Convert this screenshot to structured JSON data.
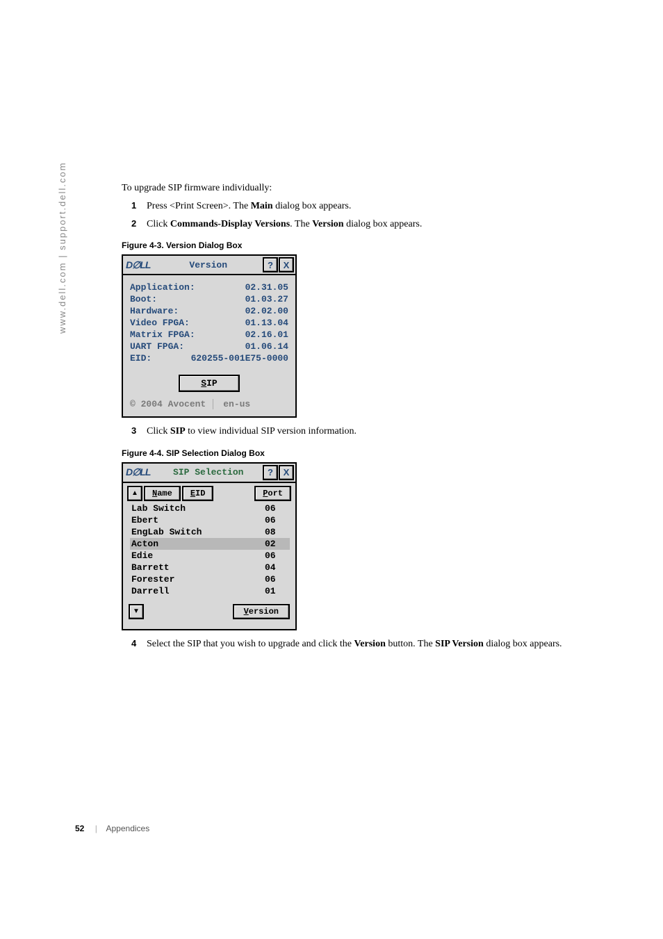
{
  "sidebar": "www.dell.com | support.dell.com",
  "intro": "To upgrade SIP firmware individually:",
  "steps_a": [
    {
      "n": "1",
      "pre": "Press <Print Screen>. The ",
      "b1": "Main",
      "post": " dialog box appears."
    },
    {
      "n": "2",
      "pre": "Click ",
      "b1": "Commands-Display Versions",
      "mid": ". The ",
      "b2": "Version",
      "post": " dialog box appears."
    }
  ],
  "fig43": {
    "caption": "Figure 4-3.    Version Dialog Box",
    "logo": "D∅LL",
    "title": "Version",
    "help": "?",
    "close": "X",
    "rows": [
      {
        "k": "Application:",
        "v": "02.31.05"
      },
      {
        "k": "Boot:",
        "v": "01.03.27"
      },
      {
        "k": "Hardware:",
        "v": "02.02.00"
      },
      {
        "k": "Video FPGA:",
        "v": "01.13.04"
      },
      {
        "k": "Matrix FPGA:",
        "v": "02.16.01"
      },
      {
        "k": "UART FPGA:",
        "v": "01.06.14"
      }
    ],
    "eid_label": "EID:",
    "eid_value": "620255-001E75-0000",
    "sip_btn_pre": "S",
    "sip_btn_rest": "IP",
    "copyright": "© 2004 Avocent",
    "lang": "en-us"
  },
  "step3": {
    "n": "3",
    "pre": "Click ",
    "b1": "SIP",
    "post": " to view individual SIP version information."
  },
  "fig44": {
    "caption": "Figure 4-4.    SIP Selection Dialog Box",
    "logo": "D∅LL",
    "title": "SIP Selection",
    "help": "?",
    "close": "X",
    "up": "▲",
    "down": "▼",
    "tab_name_u": "N",
    "tab_name_rest": "ame",
    "tab_eid_u": "E",
    "tab_eid_rest": "ID",
    "tab_port_u": "P",
    "tab_port_rest": "ort",
    "rows": [
      {
        "name": "Lab Switch",
        "port": "06",
        "sel": false
      },
      {
        "name": "Ebert",
        "port": "06",
        "sel": false
      },
      {
        "name": "EngLab Switch",
        "port": "08",
        "sel": false
      },
      {
        "name": "Acton",
        "port": "02",
        "sel": true
      },
      {
        "name": "Edie",
        "port": "06",
        "sel": false
      },
      {
        "name": "Barrett",
        "port": "04",
        "sel": false
      },
      {
        "name": "Forester",
        "port": "06",
        "sel": false
      },
      {
        "name": "Darrell",
        "port": "01",
        "sel": false
      }
    ],
    "version_btn_u": "V",
    "version_btn_rest": "ersion"
  },
  "step4": {
    "n": "4",
    "pre": "Select the SIP that you wish to upgrade and click the ",
    "b1": "Version",
    "mid": " button. The ",
    "b2": "SIP Version",
    "post": " dialog box appears."
  },
  "footer": {
    "page": "52",
    "section": "Appendices"
  }
}
